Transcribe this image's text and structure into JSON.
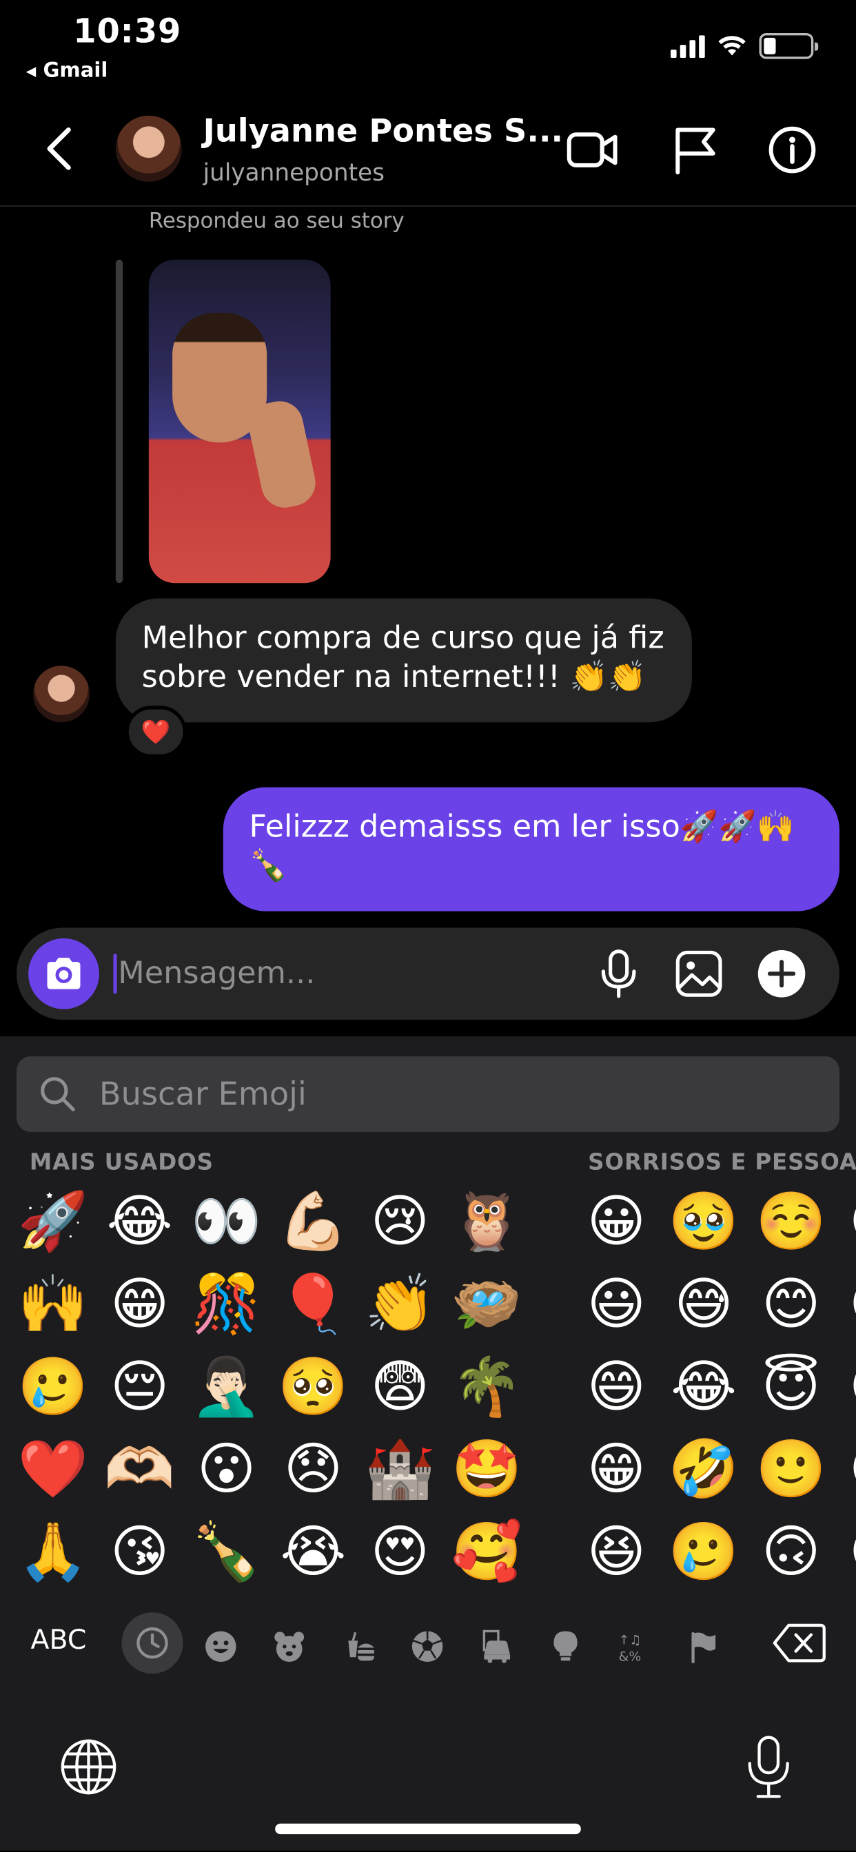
{
  "status_bar": {
    "time": "10:39",
    "back_app": "Gmail"
  },
  "header": {
    "contact_name": "Julyanne Pontes S...",
    "contact_username": "julyannepontes",
    "icons": [
      "chevron-left-icon",
      "video-call-icon",
      "flag-icon",
      "info-icon"
    ]
  },
  "thread": {
    "story_reply_label": "Respondeu ao seu story",
    "received_message": "Melhor compra de curso  que já fiz sobre vender na internet!!! 👏👏",
    "reaction": "❤️",
    "sent_message": "Felizzz demaisss em ler isso🚀🚀🙌🍾"
  },
  "composer": {
    "placeholder": "Mensagem..."
  },
  "emoji_keyboard": {
    "search_placeholder": "Buscar Emoji",
    "sections": {
      "most_used": {
        "title": "MAIS USADOS",
        "rows": [
          [
            "🚀",
            "😂",
            "👀",
            "💪🏻",
            "😢",
            "🦉"
          ],
          [
            "🙌",
            "😁",
            "🎊",
            "🎈",
            "👏",
            "🪺"
          ],
          [
            "🥲",
            "😔",
            "🤦🏻‍♂️",
            "🥺",
            "😨",
            "🌴"
          ],
          [
            "❤️",
            "🫶🏻",
            "😮",
            "😞",
            "🏰",
            "🤩"
          ],
          [
            "🙏",
            "😘",
            "🍾",
            "😭",
            "😍",
            "🥰"
          ]
        ]
      },
      "smileys": {
        "title": "SORRISOS E PESSOAS",
        "rows": [
          [
            "😀",
            "🥹",
            "☺️",
            "😊"
          ],
          [
            "😃",
            "😅",
            "😊",
            "😉"
          ],
          [
            "😄",
            "😂",
            "😇",
            "😍"
          ],
          [
            "😁",
            "🤣",
            "🙂",
            "😘"
          ],
          [
            "😆",
            "🥲",
            "🙃",
            "😗"
          ]
        ]
      }
    },
    "abc_label": "ABC",
    "categories": [
      "recent",
      "smileys",
      "animals",
      "food",
      "activity",
      "travel",
      "objects",
      "symbols",
      "flags"
    ]
  }
}
